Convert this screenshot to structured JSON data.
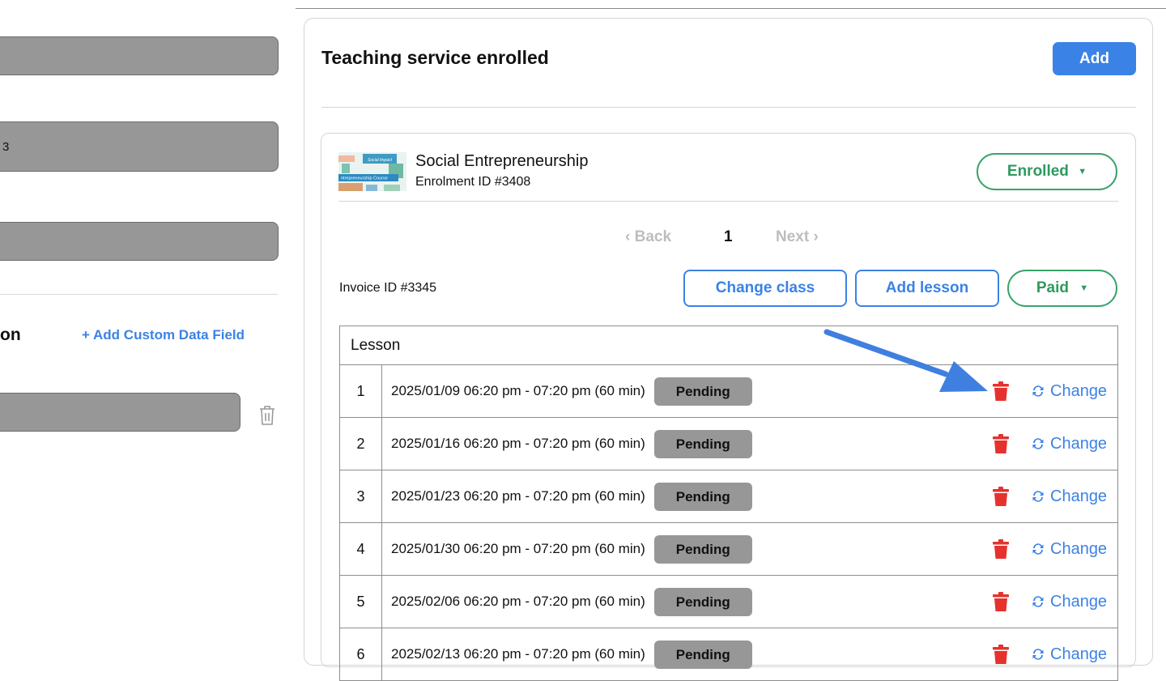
{
  "left": {
    "fields": [
      "",
      "3",
      ""
    ],
    "section_title": "on",
    "add_custom_label": "+ Add Custom Data Field",
    "custom_field_value": ""
  },
  "card": {
    "title": "Teaching service enrolled",
    "add_label": "Add"
  },
  "enrolment": {
    "course_name": "Social Entrepreneurship",
    "enrolment_id": "Enrolment ID #3408",
    "thumb_text_top": "Social Impact",
    "thumb_text_bottom": "ntrepreneurship Course",
    "status_label": "Enrolled",
    "pagination": {
      "back": "Back",
      "page": "1",
      "next": "Next"
    },
    "invoice_id": "Invoice ID #3345",
    "change_class_label": "Change class",
    "add_lesson_label": "Add lesson",
    "payment_label": "Paid"
  },
  "lessons": {
    "header": "Lesson",
    "rows": [
      {
        "num": "1",
        "time": "2025/01/09 06:20 pm - 07:20 pm (60 min)",
        "status": "Pending",
        "change": "Change"
      },
      {
        "num": "2",
        "time": "2025/01/16 06:20 pm - 07:20 pm (60 min)",
        "status": "Pending",
        "change": "Change"
      },
      {
        "num": "3",
        "time": "2025/01/23 06:20 pm - 07:20 pm (60 min)",
        "status": "Pending",
        "change": "Change"
      },
      {
        "num": "4",
        "time": "2025/01/30 06:20 pm - 07:20 pm (60 min)",
        "status": "Pending",
        "change": "Change"
      },
      {
        "num": "5",
        "time": "2025/02/06 06:20 pm - 07:20 pm (60 min)",
        "status": "Pending",
        "change": "Change"
      },
      {
        "num": "6",
        "time": "2025/02/13 06:20 pm - 07:20 pm (60 min)",
        "status": "Pending",
        "change": "Change"
      }
    ]
  },
  "colors": {
    "accent": "#3b82e6",
    "success": "#2e9a5d",
    "danger": "#e5322d",
    "badge": "#979797"
  },
  "icons": {
    "delete": "trash-icon",
    "change": "sync-icon",
    "dropdown": "caret-down-icon",
    "arrow": "pointer-arrow"
  }
}
